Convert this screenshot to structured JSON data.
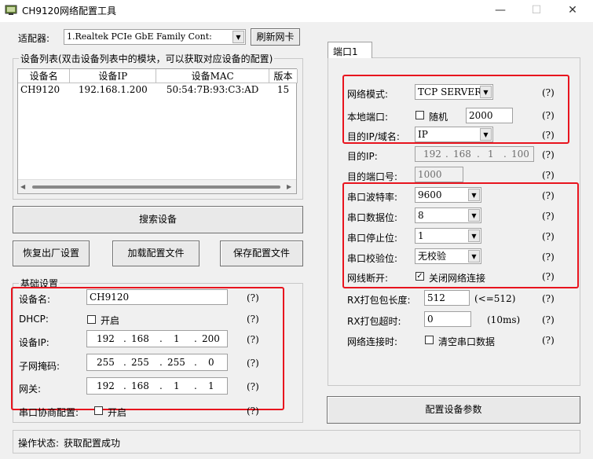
{
  "window": {
    "title": "CH9120网络配置工具",
    "minimize": "—",
    "maximize": "☐",
    "close": "✕"
  },
  "adapter": {
    "label": "适配器:",
    "value": "1.Realtek PCIe GbE Family Cont:",
    "refresh": "刷新网卡"
  },
  "device_list": {
    "title": "设备列表(双击设备列表中的模块，可以获取对应设备的配置)",
    "columns": [
      "设备名",
      "设备IP",
      "设备MAC",
      "版本"
    ],
    "rows": [
      {
        "name": "CH9120",
        "ip": "192.168.1.200",
        "mac": "50:54:7B:93:C3:AD",
        "version": "15"
      }
    ]
  },
  "buttons": {
    "search": "搜索设备",
    "restore": "恢复出厂设置",
    "load": "加载配置文件",
    "save": "保存配置文件",
    "apply": "配置设备参数"
  },
  "basic": {
    "title": "基础设置",
    "name_label": "设备名:",
    "name_value": "CH9120",
    "dhcp_label": "DHCP:",
    "dhcp_check": "开启",
    "ip_label": "设备IP:",
    "ip": [
      "192",
      "168",
      "1",
      "200"
    ],
    "mask_label": "子网掩码:",
    "mask": [
      "255",
      "255",
      "255",
      "0"
    ],
    "gw_label": "网关:",
    "gw": [
      "192",
      "168",
      "1",
      "1"
    ],
    "serial_label": "串口协商配置:",
    "serial_check": "开启",
    "help": "(?)"
  },
  "port": {
    "tab": "端口1",
    "mode_label": "网络模式:",
    "mode_value": "TCP SERVER",
    "local_port_label": "本地端口:",
    "random_label": "随机",
    "local_port_value": "2000",
    "target_label": "目的IP/域名:",
    "target_value": "IP",
    "dest_ip_label": "目的IP:",
    "dest_ip": [
      "192",
      "168",
      "1",
      "100"
    ],
    "dest_port_label": "目的端口号:",
    "dest_port_value": "1000",
    "baud_label": "串口波特率:",
    "baud_value": "9600",
    "data_label": "串口数据位:",
    "data_value": "8",
    "stop_label": "串口停止位:",
    "stop_value": "1",
    "parity_label": "串口校验位:",
    "parity_value": "无校验",
    "disconnect_label": "网线断开:",
    "disconnect_check": "关闭网络连接",
    "rx_len_label": "RX打包包长度:",
    "rx_len_value": "512",
    "rx_len_hint": "(<=512)",
    "rx_timeout_label": "RX打包超时:",
    "rx_timeout_value": "0",
    "rx_timeout_hint": "(10ms)",
    "net_conn_label": "网络连接时:",
    "net_conn_check": "清空串口数据",
    "help": "(?)"
  },
  "status": {
    "label": "操作状态:",
    "value": "获取配置成功"
  },
  "colors": {
    "highlight": "#e8141e"
  }
}
